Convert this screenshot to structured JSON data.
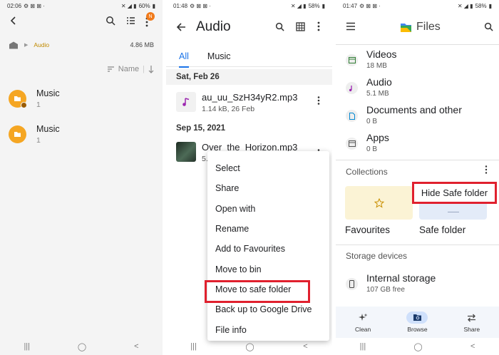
{
  "panel1": {
    "status": {
      "time": "02:06",
      "battery": "60%"
    },
    "toolbar": {
      "notif_badge": "N"
    },
    "path": {
      "crumb": "Audio",
      "size": "4.86 MB"
    },
    "sort": {
      "label": "Name"
    },
    "folders": [
      {
        "name": "Music",
        "count": "1"
      },
      {
        "name": "Music",
        "count": "1"
      }
    ],
    "nav": {
      "recents": "|||",
      "home": "◯",
      "back": "<"
    }
  },
  "panel2": {
    "status": {
      "time": "01:48",
      "battery": "58%"
    },
    "title": "Audio",
    "tabs": [
      {
        "label": "All"
      },
      {
        "label": "Music"
      }
    ],
    "sections": [
      {
        "date": "Sat, Feb 26",
        "file": {
          "name": "au_uu_SzH34yR2.mp3",
          "meta": "1.14 kB, 26 Feb"
        }
      },
      {
        "date": "Sep 15, 2021",
        "file": {
          "name": "Over_the_Horizon.mp3",
          "meta": "5."
        }
      }
    ],
    "menu": [
      "Select",
      "Share",
      "Open with",
      "Rename",
      "Add to Favourites",
      "Move to bin",
      "Move to safe folder",
      "Back up to Google Drive",
      "File info"
    ],
    "nav": {
      "recents": "|||",
      "home": "◯",
      "back": "<"
    }
  },
  "panel3": {
    "status": {
      "time": "01:47",
      "battery": "58%"
    },
    "title": "Files",
    "categories": [
      {
        "title": "Videos",
        "sub": "18 MB"
      },
      {
        "title": "Audio",
        "sub": "5.1 MB"
      },
      {
        "title": "Documents and other",
        "sub": "0 B"
      },
      {
        "title": "Apps",
        "sub": "0 B"
      }
    ],
    "collections_title": "Collections",
    "collections": [
      {
        "label": "Favourites"
      },
      {
        "label": "Safe folder"
      }
    ],
    "hide_safe_folder": "Hide Safe folder",
    "storage_title": "Storage devices",
    "storage": {
      "name": "Internal storage",
      "free": "107 GB free"
    },
    "bottom_nav": [
      {
        "label": "Clean"
      },
      {
        "label": "Browse"
      },
      {
        "label": "Share"
      }
    ],
    "nav": {
      "recents": "|||",
      "home": "◯",
      "back": "<"
    }
  },
  "colors": {
    "accent_blue": "#1a73e8",
    "highlight_red": "#e0202e",
    "folder_orange": "#f5a623",
    "crumb_gold": "#c08a00"
  }
}
